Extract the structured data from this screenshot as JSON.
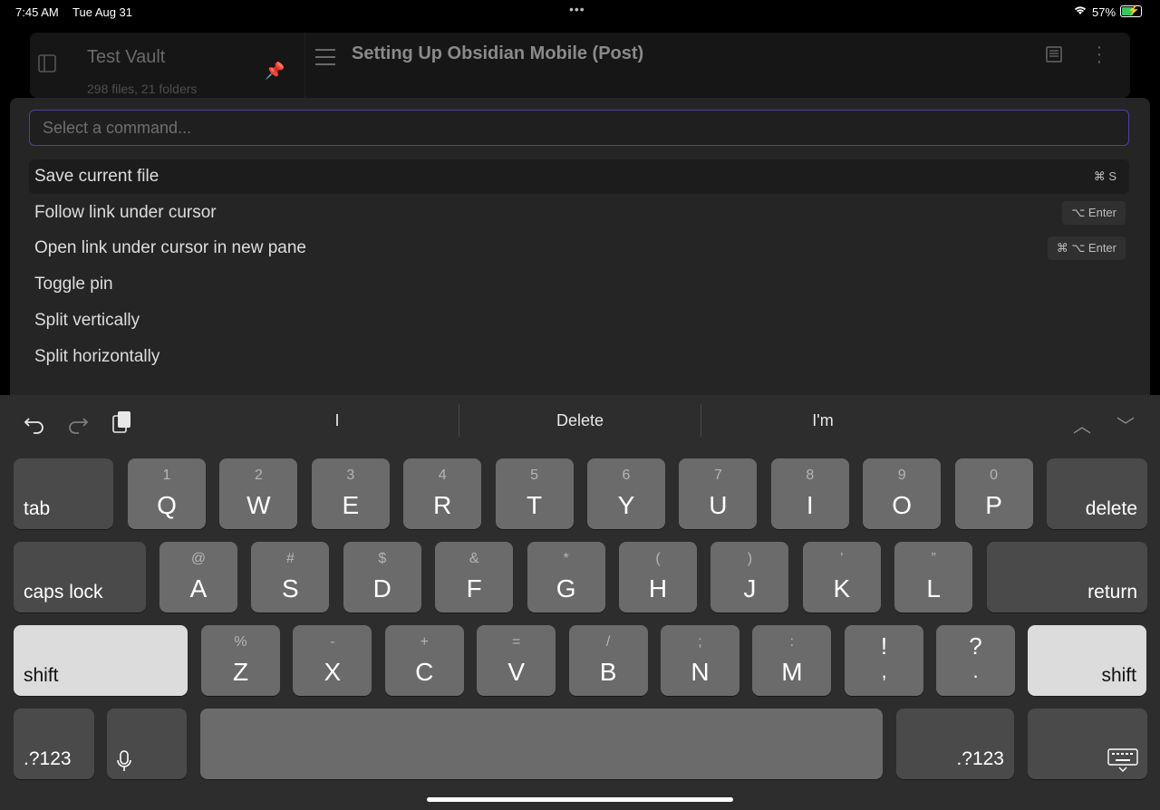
{
  "status_bar": {
    "time": "7:45 AM",
    "date": "Tue Aug 31",
    "battery": "57%"
  },
  "vault": {
    "name": "Test Vault",
    "stats": "298 files, 21 folders"
  },
  "document": {
    "title": "Setting Up Obsidian Mobile (Post)"
  },
  "palette": {
    "placeholder": "Select a command...",
    "value": "",
    "commands": [
      {
        "label": "Save current file",
        "hotkey": "⌘ S"
      },
      {
        "label": "Follow link under cursor",
        "hotkey": "⌥ Enter"
      },
      {
        "label": "Open link under cursor in new pane",
        "hotkey": "⌘ ⌥ Enter"
      },
      {
        "label": "Toggle pin",
        "hotkey": ""
      },
      {
        "label": "Split vertically",
        "hotkey": ""
      },
      {
        "label": "Split horizontally",
        "hotkey": ""
      }
    ]
  },
  "keyboard": {
    "suggestions": [
      "I",
      "Delete",
      "I'm"
    ],
    "row1": [
      {
        "sec": "1",
        "pri": "Q"
      },
      {
        "sec": "2",
        "pri": "W"
      },
      {
        "sec": "3",
        "pri": "E"
      },
      {
        "sec": "4",
        "pri": "R"
      },
      {
        "sec": "5",
        "pri": "T"
      },
      {
        "sec": "6",
        "pri": "Y"
      },
      {
        "sec": "7",
        "pri": "U"
      },
      {
        "sec": "8",
        "pri": "I"
      },
      {
        "sec": "9",
        "pri": "O"
      },
      {
        "sec": "0",
        "pri": "P"
      }
    ],
    "row2": [
      {
        "sec": "@",
        "pri": "A"
      },
      {
        "sec": "#",
        "pri": "S"
      },
      {
        "sec": "$",
        "pri": "D"
      },
      {
        "sec": "&",
        "pri": "F"
      },
      {
        "sec": "*",
        "pri": "G"
      },
      {
        "sec": "(",
        "pri": "H"
      },
      {
        "sec": ")",
        "pri": "J"
      },
      {
        "sec": "’",
        "pri": "K"
      },
      {
        "sec": "”",
        "pri": "L"
      }
    ],
    "row3": [
      {
        "sec": "%",
        "pri": "Z"
      },
      {
        "sec": "-",
        "pri": "X"
      },
      {
        "sec": "+",
        "pri": "C"
      },
      {
        "sec": "=",
        "pri": "V"
      },
      {
        "sec": "/",
        "pri": "B"
      },
      {
        "sec": ";",
        "pri": "N"
      },
      {
        "sec": ":",
        "pri": "M"
      }
    ],
    "punct": [
      {
        "top": "!",
        "bottom": ","
      },
      {
        "top": "?",
        "bottom": "."
      }
    ],
    "mods": {
      "tab": "tab",
      "delete": "delete",
      "caps": "caps lock",
      "return": "return",
      "shift_left": "shift",
      "shift_right": "shift",
      "num_left": ".?123",
      "num_right": ".?123"
    }
  }
}
